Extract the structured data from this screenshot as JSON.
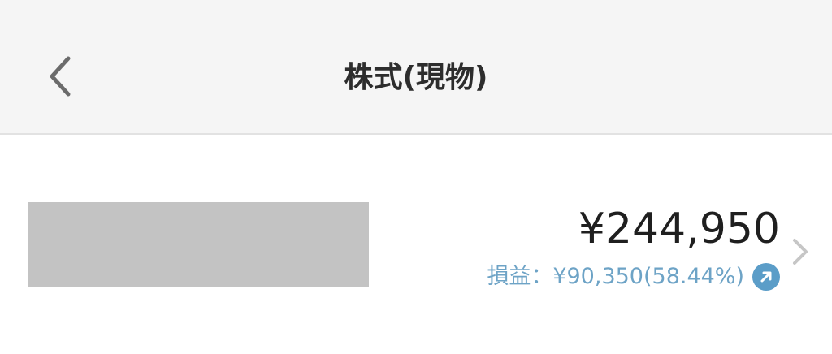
{
  "header": {
    "title": "株式(現物)",
    "back_icon": "chevron-left-icon"
  },
  "holding": {
    "name_redacted": true,
    "value": "¥244,950",
    "profit_loss_label": "損益：¥90,350(58.44%)",
    "trend_icon": "arrow-up-right-icon",
    "chevron_icon": "chevron-right-icon"
  },
  "colors": {
    "header_bg": "#f5f5f5",
    "accent": "#5b9dc8",
    "profit_text": "#6da3c6",
    "redaction": "#c3c3c3"
  }
}
